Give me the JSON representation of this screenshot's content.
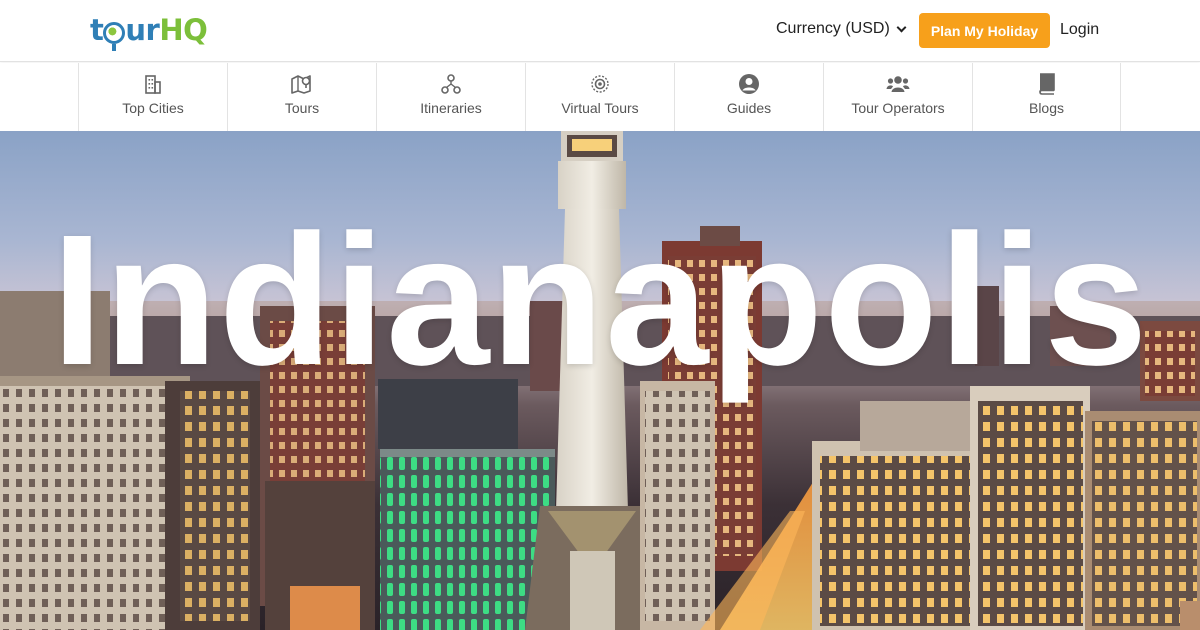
{
  "brand": {
    "logo_parts": [
      "t",
      "ur",
      "HQ"
    ],
    "logo_text": "tourHQ",
    "primary": "#2f7fb6",
    "accent": "#7cbf3a"
  },
  "header": {
    "currency_label": "Currency (USD)",
    "plan_button": "Plan My Holiday",
    "plan_button_color": "#f7a01b",
    "login_label": "Login"
  },
  "nav": {
    "items": [
      {
        "label": "Top Cities",
        "icon": "building-icon"
      },
      {
        "label": "Tours",
        "icon": "map-pin-icon"
      },
      {
        "label": "Itineraries",
        "icon": "nodes-icon"
      },
      {
        "label": "Virtual Tours",
        "icon": "vr-icon"
      },
      {
        "label": "Guides",
        "icon": "user-circle-icon"
      },
      {
        "label": "Tour Operators",
        "icon": "group-icon"
      },
      {
        "label": "Blogs",
        "icon": "book-icon"
      }
    ]
  },
  "hero": {
    "title": "Indianapolis"
  }
}
